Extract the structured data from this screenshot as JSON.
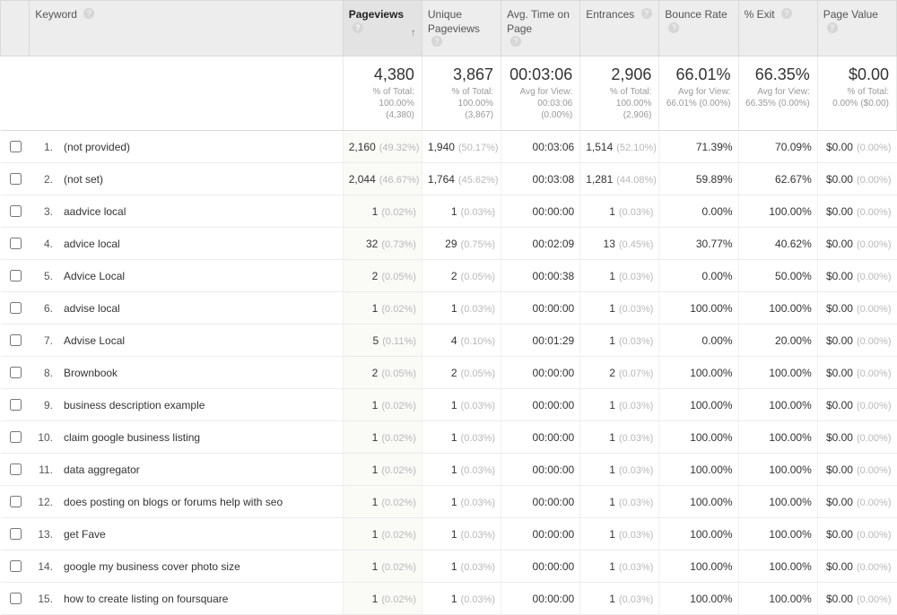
{
  "columns": {
    "keyword": "Keyword",
    "pageviews": "Pageviews",
    "unique": "Unique Pageviews",
    "avgtime": "Avg. Time on Page",
    "entrances": "Entrances",
    "bounce": "Bounce Rate",
    "exit": "% Exit",
    "value": "Page Value"
  },
  "summary": {
    "pageviews": {
      "main": "4,380",
      "label": "% of Total:",
      "detail": "100.00% (4,380)"
    },
    "unique": {
      "main": "3,867",
      "label": "% of Total:",
      "detail": "100.00% (3,867)"
    },
    "avgtime": {
      "main": "00:03:06",
      "label": "Avg for View:",
      "detail": "00:03:06 (0.00%)"
    },
    "entrances": {
      "main": "2,906",
      "label": "% of Total:",
      "detail": "100.00% (2,906)"
    },
    "bounce": {
      "main": "66.01%",
      "label": "Avg for View:",
      "detail": "66.01% (0.00%)"
    },
    "exit": {
      "main": "66.35%",
      "label": "Avg for View:",
      "detail": "66.35% (0.00%)"
    },
    "value": {
      "main": "$0.00",
      "label": "% of Total:",
      "detail": "0.00% ($0.00)"
    }
  },
  "rows": [
    {
      "idx": "1.",
      "keyword": "(not provided)",
      "pv": "2,160",
      "pv_pct": "(49.32%)",
      "uv": "1,940",
      "uv_pct": "(50.17%)",
      "time": "00:03:06",
      "ent": "1,514",
      "ent_pct": "(52.10%)",
      "bounce": "71.39%",
      "exit": "70.09%",
      "val": "$0.00",
      "val_pct": "(0.00%)"
    },
    {
      "idx": "2.",
      "keyword": "(not set)",
      "pv": "2,044",
      "pv_pct": "(46.67%)",
      "uv": "1,764",
      "uv_pct": "(45.62%)",
      "time": "00:03:08",
      "ent": "1,281",
      "ent_pct": "(44.08%)",
      "bounce": "59.89%",
      "exit": "62.67%",
      "val": "$0.00",
      "val_pct": "(0.00%)"
    },
    {
      "idx": "3.",
      "keyword": "aadvice local",
      "pv": "1",
      "pv_pct": "(0.02%)",
      "uv": "1",
      "uv_pct": "(0.03%)",
      "time": "00:00:00",
      "ent": "1",
      "ent_pct": "(0.03%)",
      "bounce": "0.00%",
      "exit": "100.00%",
      "val": "$0.00",
      "val_pct": "(0.00%)"
    },
    {
      "idx": "4.",
      "keyword": "advice local",
      "pv": "32",
      "pv_pct": "(0.73%)",
      "uv": "29",
      "uv_pct": "(0.75%)",
      "time": "00:02:09",
      "ent": "13",
      "ent_pct": "(0.45%)",
      "bounce": "30.77%",
      "exit": "40.62%",
      "val": "$0.00",
      "val_pct": "(0.00%)"
    },
    {
      "idx": "5.",
      "keyword": "Advice Local",
      "pv": "2",
      "pv_pct": "(0.05%)",
      "uv": "2",
      "uv_pct": "(0.05%)",
      "time": "00:00:38",
      "ent": "1",
      "ent_pct": "(0.03%)",
      "bounce": "0.00%",
      "exit": "50.00%",
      "val": "$0.00",
      "val_pct": "(0.00%)"
    },
    {
      "idx": "6.",
      "keyword": "advise local",
      "pv": "1",
      "pv_pct": "(0.02%)",
      "uv": "1",
      "uv_pct": "(0.03%)",
      "time": "00:00:00",
      "ent": "1",
      "ent_pct": "(0.03%)",
      "bounce": "100.00%",
      "exit": "100.00%",
      "val": "$0.00",
      "val_pct": "(0.00%)"
    },
    {
      "idx": "7.",
      "keyword": "Advise Local",
      "pv": "5",
      "pv_pct": "(0.11%)",
      "uv": "4",
      "uv_pct": "(0.10%)",
      "time": "00:01:29",
      "ent": "1",
      "ent_pct": "(0.03%)",
      "bounce": "0.00%",
      "exit": "20.00%",
      "val": "$0.00",
      "val_pct": "(0.00%)"
    },
    {
      "idx": "8.",
      "keyword": "Brownbook",
      "pv": "2",
      "pv_pct": "(0.05%)",
      "uv": "2",
      "uv_pct": "(0.05%)",
      "time": "00:00:00",
      "ent": "2",
      "ent_pct": "(0.07%)",
      "bounce": "100.00%",
      "exit": "100.00%",
      "val": "$0.00",
      "val_pct": "(0.00%)"
    },
    {
      "idx": "9.",
      "keyword": "business description example",
      "pv": "1",
      "pv_pct": "(0.02%)",
      "uv": "1",
      "uv_pct": "(0.03%)",
      "time": "00:00:00",
      "ent": "1",
      "ent_pct": "(0.03%)",
      "bounce": "100.00%",
      "exit": "100.00%",
      "val": "$0.00",
      "val_pct": "(0.00%)"
    },
    {
      "idx": "10.",
      "keyword": "claim google business listing",
      "pv": "1",
      "pv_pct": "(0.02%)",
      "uv": "1",
      "uv_pct": "(0.03%)",
      "time": "00:00:00",
      "ent": "1",
      "ent_pct": "(0.03%)",
      "bounce": "100.00%",
      "exit": "100.00%",
      "val": "$0.00",
      "val_pct": "(0.00%)"
    },
    {
      "idx": "11.",
      "keyword": "data aggregator",
      "pv": "1",
      "pv_pct": "(0.02%)",
      "uv": "1",
      "uv_pct": "(0.03%)",
      "time": "00:00:00",
      "ent": "1",
      "ent_pct": "(0.03%)",
      "bounce": "100.00%",
      "exit": "100.00%",
      "val": "$0.00",
      "val_pct": "(0.00%)"
    },
    {
      "idx": "12.",
      "keyword": "does posting on blogs or forums help with seo",
      "pv": "1",
      "pv_pct": "(0.02%)",
      "uv": "1",
      "uv_pct": "(0.03%)",
      "time": "00:00:00",
      "ent": "1",
      "ent_pct": "(0.03%)",
      "bounce": "100.00%",
      "exit": "100.00%",
      "val": "$0.00",
      "val_pct": "(0.00%)"
    },
    {
      "idx": "13.",
      "keyword": "get Fave",
      "pv": "1",
      "pv_pct": "(0.02%)",
      "uv": "1",
      "uv_pct": "(0.03%)",
      "time": "00:00:00",
      "ent": "1",
      "ent_pct": "(0.03%)",
      "bounce": "100.00%",
      "exit": "100.00%",
      "val": "$0.00",
      "val_pct": "(0.00%)"
    },
    {
      "idx": "14.",
      "keyword": "google my business cover photo size",
      "pv": "1",
      "pv_pct": "(0.02%)",
      "uv": "1",
      "uv_pct": "(0.03%)",
      "time": "00:00:00",
      "ent": "1",
      "ent_pct": "(0.03%)",
      "bounce": "100.00%",
      "exit": "100.00%",
      "val": "$0.00",
      "val_pct": "(0.00%)"
    },
    {
      "idx": "15.",
      "keyword": "how to create listing on foursquare",
      "pv": "1",
      "pv_pct": "(0.02%)",
      "uv": "1",
      "uv_pct": "(0.03%)",
      "time": "00:00:00",
      "ent": "1",
      "ent_pct": "(0.03%)",
      "bounce": "100.00%",
      "exit": "100.00%",
      "val": "$0.00",
      "val_pct": "(0.00%)"
    }
  ]
}
